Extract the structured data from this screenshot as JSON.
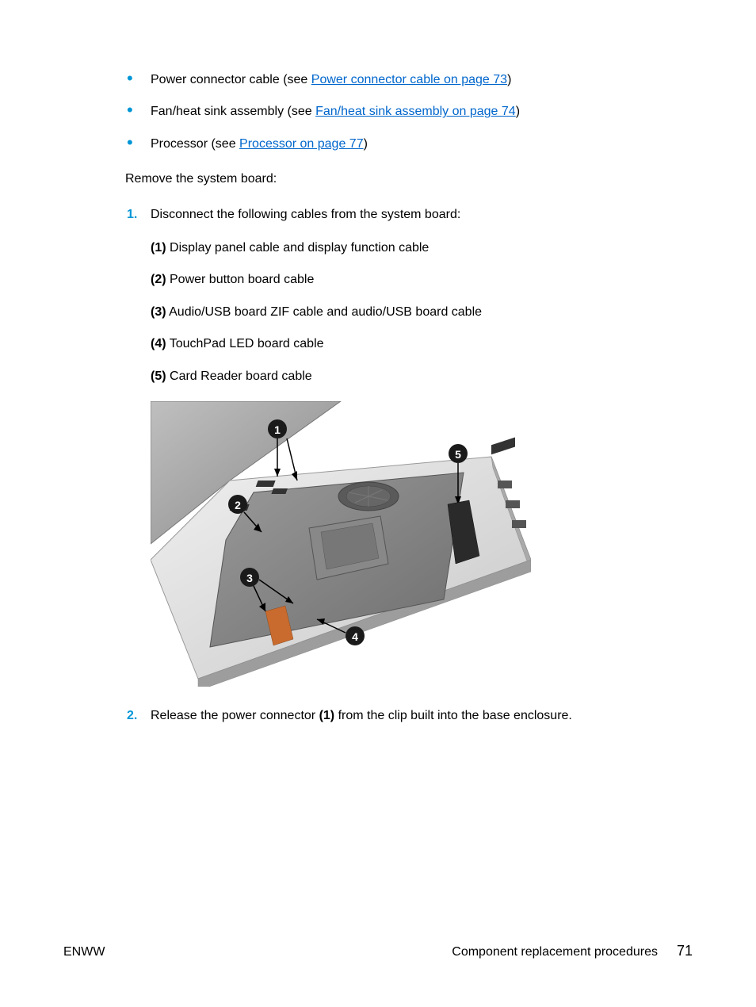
{
  "bullets": [
    {
      "prefix": "Power connector cable (see ",
      "link": "Power connector cable on page 73",
      "suffix": ")"
    },
    {
      "prefix": "Fan/heat sink assembly (see ",
      "link": "Fan/heat sink assembly on page 74",
      "suffix": ")"
    },
    {
      "prefix": "Processor (see ",
      "link": "Processor on page 77",
      "suffix": ")"
    }
  ],
  "instruction": "Remove the system board:",
  "steps": {
    "s1": {
      "num": "1.",
      "text": "Disconnect the following cables from the system board:",
      "sub": [
        {
          "n": "(1)",
          "t": " Display panel cable and display function cable"
        },
        {
          "n": "(2)",
          "t": " Power button board cable"
        },
        {
          "n": "(3)",
          "t": " Audio/USB board ZIF cable and audio/USB board cable"
        },
        {
          "n": "(4)",
          "t": " TouchPad LED board cable"
        },
        {
          "n": "(5)",
          "t": " Card Reader board cable"
        }
      ]
    },
    "s2": {
      "num": "2.",
      "pre": "Release the power connector ",
      "bold": "(1)",
      "post": " from the clip built into the base enclosure."
    }
  },
  "footer": {
    "left": "ENWW",
    "right_text": "Component replacement procedures",
    "page": "71"
  },
  "callouts": {
    "c1": "1",
    "c2": "2",
    "c3": "3",
    "c4": "4",
    "c5": "5"
  }
}
